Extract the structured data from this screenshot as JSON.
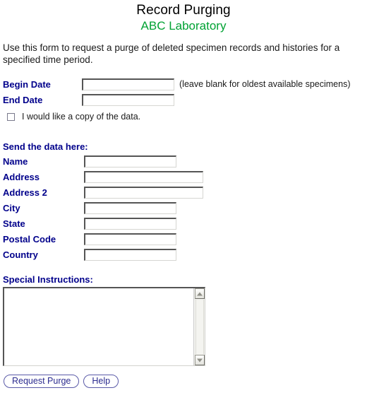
{
  "header": {
    "title": "Record Purging",
    "subtitle": "ABC Laboratory",
    "subtitle_color": "#00a233",
    "intro": "Use this form to request a purge of deleted specimen records and histories for a specified time period."
  },
  "dates": {
    "begin_label": "Begin Date",
    "begin_value": "",
    "end_label": "End Date",
    "end_value": "",
    "hint": "(leave blank for oldest available specimens)"
  },
  "copy_option": {
    "label": "I would like a copy of the data.",
    "checked": false
  },
  "send_section": {
    "heading": "Send the data here:",
    "fields": [
      {
        "label": "Name",
        "value": "",
        "wide": false
      },
      {
        "label": "Address",
        "value": "",
        "wide": true
      },
      {
        "label": "Address 2",
        "value": "",
        "wide": true
      },
      {
        "label": "City",
        "value": "",
        "wide": false
      },
      {
        "label": "State",
        "value": "",
        "wide": false
      },
      {
        "label": "Postal Code",
        "value": "",
        "wide": false
      },
      {
        "label": "Country",
        "value": "",
        "wide": false
      }
    ]
  },
  "special": {
    "heading": "Special Instructions:",
    "value": ""
  },
  "buttons": {
    "submit_label": "Request Purge",
    "help_label": "Help",
    "text_color": "#2b2b8f"
  },
  "theme": {
    "label_color": "#00008b",
    "body_text_color": "#1a1a1a",
    "background": "#ffffff"
  }
}
